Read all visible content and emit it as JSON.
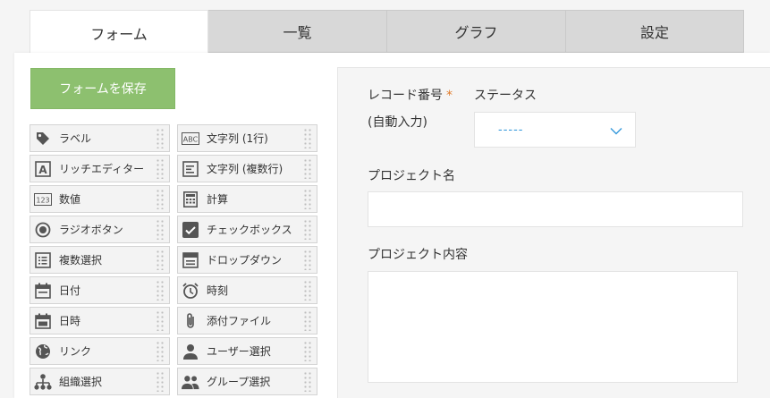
{
  "tabs": [
    {
      "label": "フォーム"
    },
    {
      "label": "一覧"
    },
    {
      "label": "グラフ"
    },
    {
      "label": "設定"
    }
  ],
  "save_button": {
    "label": "フォームを保存"
  },
  "palette": [
    {
      "label": "ラベル",
      "icon": "tag-icon"
    },
    {
      "label": "文字列 (1行)",
      "icon": "abc-text-icon"
    },
    {
      "label": "リッチエディター",
      "icon": "rich-editor-icon"
    },
    {
      "label": "文字列 (複数行)",
      "icon": "multiline-text-icon"
    },
    {
      "label": "数値",
      "icon": "number-123-icon"
    },
    {
      "label": "計算",
      "icon": "calculator-icon"
    },
    {
      "label": "ラジオボタン",
      "icon": "radio-button-icon"
    },
    {
      "label": "チェックボックス",
      "icon": "checkbox-icon"
    },
    {
      "label": "複数選択",
      "icon": "multi-select-icon"
    },
    {
      "label": "ドロップダウン",
      "icon": "dropdown-icon"
    },
    {
      "label": "日付",
      "icon": "calendar-icon"
    },
    {
      "label": "時刻",
      "icon": "alarm-clock-icon"
    },
    {
      "label": "日時",
      "icon": "calendar-datetime-icon"
    },
    {
      "label": "添付ファイル",
      "icon": "paperclip-icon"
    },
    {
      "label": "リンク",
      "icon": "globe-icon"
    },
    {
      "label": "ユーザー選択",
      "icon": "user-icon"
    },
    {
      "label": "組織選択",
      "icon": "org-chart-icon"
    },
    {
      "label": "グループ選択",
      "icon": "group-icon"
    }
  ],
  "form": {
    "record_number_label": "レコード番号",
    "required_mark": "*",
    "auto_input_label": "(自動入力)",
    "status_label": "ステータス",
    "status_value": "-----",
    "project_name_label": "プロジェクト名",
    "project_content_label": "プロジェクト内容"
  },
  "colors": {
    "save_button": "#8dc06f",
    "required": "#e07b2b",
    "dropdown_value": "#3498db"
  }
}
